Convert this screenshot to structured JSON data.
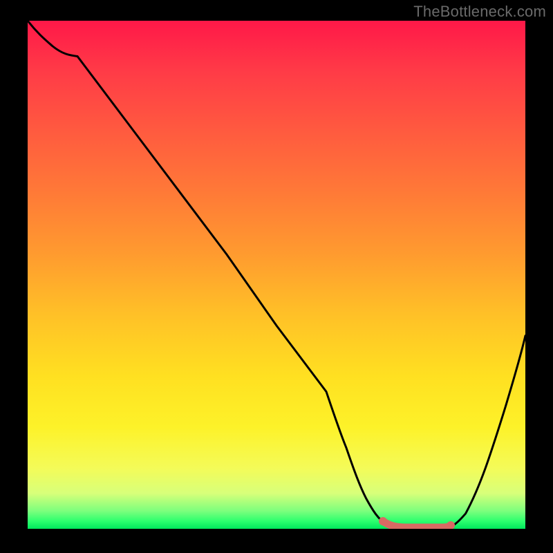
{
  "watermark": "TheBottleneck.com",
  "chart_data": {
    "type": "line",
    "title": "",
    "xlabel": "",
    "ylabel": "",
    "xlim": [
      0,
      100
    ],
    "ylim": [
      0,
      100
    ],
    "grid": false,
    "x": [
      0,
      5,
      10,
      20,
      30,
      40,
      50,
      60,
      64,
      68,
      72,
      76,
      80,
      84,
      88,
      92,
      96,
      100
    ],
    "series": [
      {
        "name": "bottleneck-curve",
        "values": [
          100,
          95,
          93,
          80,
          67,
          54,
          40,
          27,
          16,
          6,
          1,
          0,
          0,
          0,
          3,
          12,
          24,
          38
        ],
        "color": "#000000"
      }
    ],
    "highlight_segment": {
      "name": "optimal-range",
      "x_start": 72,
      "x_end": 84,
      "color": "#d86a63"
    },
    "background_gradient": {
      "stops": [
        {
          "pos": 0,
          "color": "#ff1848"
        },
        {
          "pos": 50,
          "color": "#ffb030"
        },
        {
          "pos": 80,
          "color": "#fff23a"
        },
        {
          "pos": 100,
          "color": "#00e65c"
        }
      ],
      "direction": "top-to-bottom"
    }
  }
}
